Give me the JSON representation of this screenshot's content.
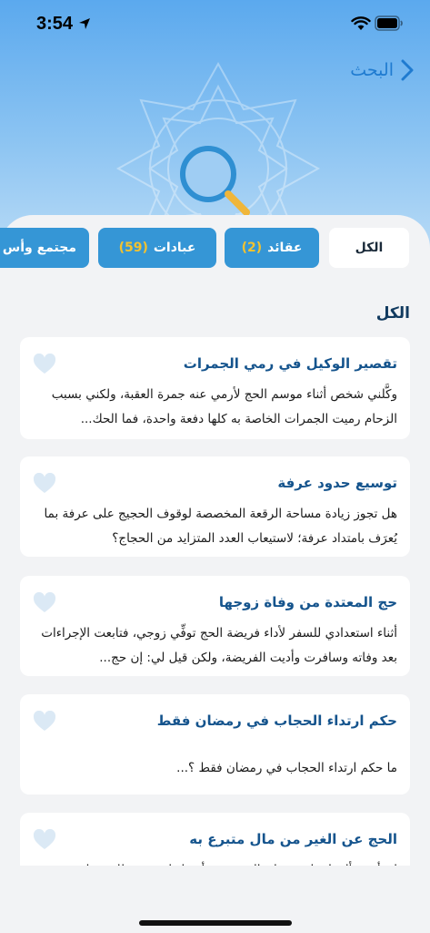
{
  "status_bar": {
    "time": "3:54"
  },
  "header": {
    "back_label": "البحث"
  },
  "tabs": [
    {
      "label": "الكل",
      "count": "",
      "active": true
    },
    {
      "label": "عقائد",
      "count": "(2)",
      "active": false
    },
    {
      "label": "عبادات",
      "count": "(59)",
      "active": false
    },
    {
      "label": "مجتمع وأس",
      "count": "",
      "active": false
    }
  ],
  "section_title": "الكل",
  "results": [
    {
      "title": "تقصير الوكيل في رمي الجمرات",
      "snippet": "وكَّلني شخص أثناء موسم الحج لأرمي عنه جمرة العقبة، ولكني بسبب الزحام رميت الجمرات الخاصة به كلها دفعة واحدة، فما الحك..."
    },
    {
      "title": "توسيع حدود عرفة",
      "snippet": "هل تجوز زيادة مساحة الرقعة المخصصة لوقوف الحجيج على عرفة بما يُعرَف بامتداد عرفة؛ لاستيعاب العدد المتزايد من الحجاج؟"
    },
    {
      "title": "حج المعتدة من وفاة زوجها",
      "snippet": "أثناء استعدادي للسفر لأداء فريضة الحج توفِّي زوجي، فتابعت الإجراءات بعد وفاته وسافرت وأديت الفريضة، ولكن قيل لي: إن حج..."
    },
    {
      "title": "حكم ارتداء الحجاب في رمضان فقط",
      "snippet": "ما حكم ارتداء الحجاب في رمضان فقط ؟..."
    },
    {
      "title": "الحج عن الغير من مال متبرع به",
      "snippet": "امرأة تسأل: لي ابن يعمل بالسعودية وأرسل لي دعوة للحج على"
    }
  ],
  "colors": {
    "accent": "#3596d6",
    "title_blue": "#15548d",
    "badge_yellow": "#f2c230",
    "heart": "#dbe9f5"
  },
  "icons": {
    "back": "chevron-right-icon",
    "search": "magnifier-icon",
    "favorite": "heart-icon"
  }
}
